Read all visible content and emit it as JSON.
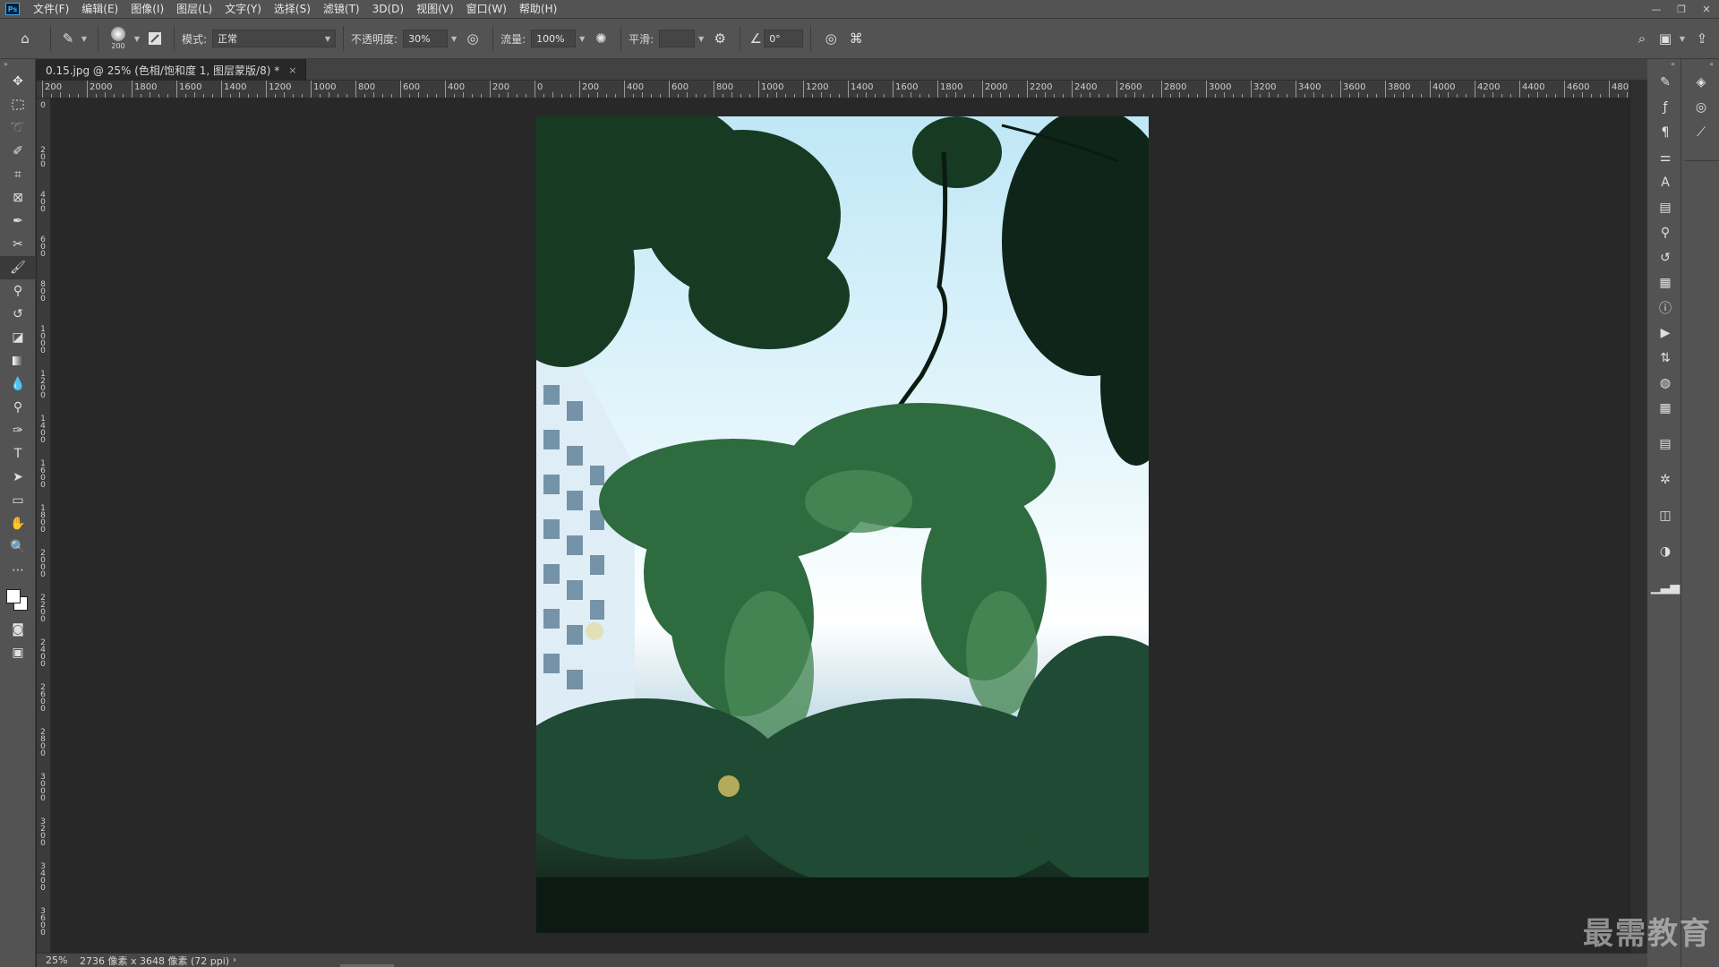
{
  "menubar": {
    "logo": "Ps",
    "items": [
      "文件(F)",
      "编辑(E)",
      "图像(I)",
      "图层(L)",
      "文字(Y)",
      "选择(S)",
      "滤镜(T)",
      "3D(D)",
      "视图(V)",
      "窗口(W)",
      "帮助(H)"
    ],
    "window_controls": [
      "—",
      "❐",
      "✕"
    ]
  },
  "options": {
    "brush_size": "200",
    "mode_label": "模式:",
    "mode_value": "正常",
    "opacity_label": "不透明度:",
    "opacity_value": "30%",
    "flow_label": "流量:",
    "flow_value": "100%",
    "smoothing_label": "平滑:",
    "smoothing_value": "",
    "angle_value": "0°"
  },
  "document": {
    "tab_title": "0.15.jpg @ 25% (色相/饱和度 1, 图层蒙版/8) *",
    "tab_close": "×"
  },
  "ruler": {
    "h_labels": [
      "200",
      "2000",
      "1800",
      "1600",
      "1400",
      "1200",
      "1000",
      "800",
      "600",
      "400",
      "200",
      "0",
      "200",
      "400",
      "600",
      "800",
      "1000",
      "1200",
      "1400",
      "1600",
      "1800",
      "2000",
      "2200",
      "2400",
      "2600",
      "2800",
      "3000",
      "3200",
      "3400",
      "3600",
      "3800",
      "4000",
      "4200",
      "4400",
      "4600",
      "480"
    ],
    "v_labels": [
      "0",
      "200",
      "400",
      "600",
      "800",
      "1000",
      "1200",
      "1400",
      "1600",
      "1800",
      "2000",
      "2200",
      "2400",
      "2600",
      "2800",
      "3000",
      "3200",
      "3400",
      "3600"
    ]
  },
  "status": {
    "zoom": "25%",
    "info": "2736 像素 x 3648 像素 (72 ppi)",
    "arrow": "›"
  },
  "watermark": "最需教育",
  "icons": {
    "home": "⌂",
    "brush": "✎",
    "airbrush": "✺",
    "settings": "⚙",
    "angle": "∠",
    "pressure": "◎",
    "symmetry": "⌘",
    "search": "⌕",
    "workspace": "▣",
    "share": "⇪"
  }
}
